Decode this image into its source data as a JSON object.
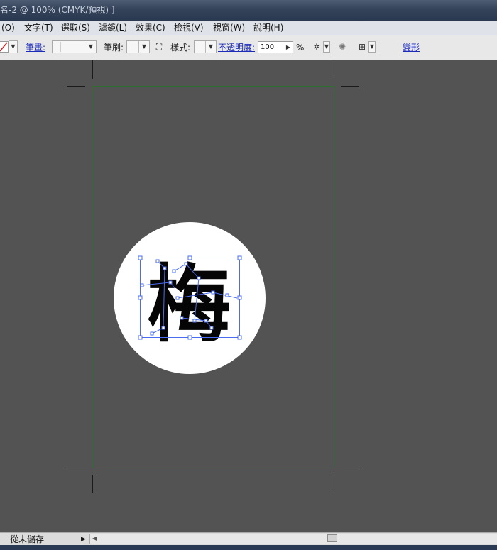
{
  "window": {
    "title": "名-2 @ 100% (CMYK/預視) ]"
  },
  "menu": [
    {
      "id": "object",
      "label": "(O)"
    },
    {
      "id": "type",
      "label": "文字(T)"
    },
    {
      "id": "select",
      "label": "選取(S)"
    },
    {
      "id": "effect_filter",
      "label": "濾鏡(L)"
    },
    {
      "id": "effect",
      "label": "效果(C)"
    },
    {
      "id": "view",
      "label": "檢視(V)"
    },
    {
      "id": "window",
      "label": "視窗(W)"
    },
    {
      "id": "help",
      "label": "說明(H)"
    }
  ],
  "control": {
    "stroke_label": "筆畫:",
    "brush_label": "筆刷:",
    "style_label": "樣式:",
    "opacity_label": "不透明度:",
    "opacity_value": "100",
    "opacity_unit": "%",
    "transform_label": "變形"
  },
  "canvas": {
    "artwork_text": "梅"
  },
  "status": {
    "label": "從未儲存"
  },
  "colors": {
    "canvas_bg": "#535353",
    "selection_blue": "#4a6cf0",
    "artboard_border": "#2f6f2f"
  }
}
